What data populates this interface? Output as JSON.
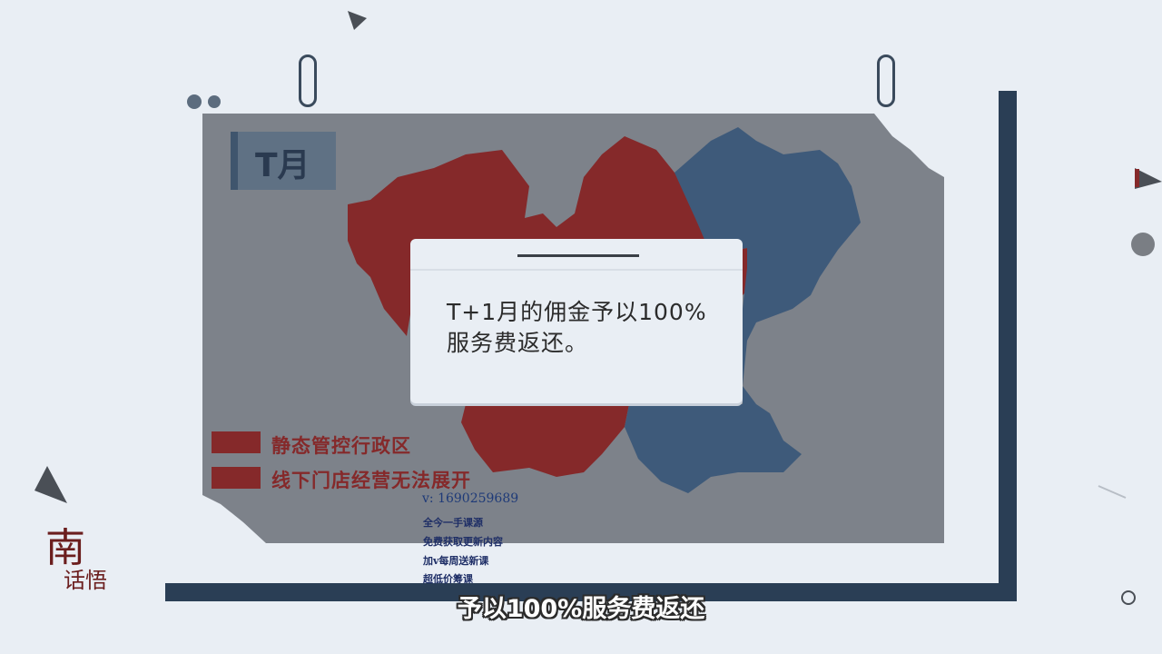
{
  "panel": {
    "month_badge": "T月",
    "legend": [
      {
        "label": "静态管控行政区",
        "color": "#85292a"
      },
      {
        "label": "线下门店经营无法展开",
        "color": "#85292a"
      }
    ],
    "map_colors": {
      "red_region": "#85292a",
      "blue_region": "#3e5a7a"
    }
  },
  "dialog": {
    "text": "T+1月的佣金予以100%服务费返还。"
  },
  "watermark": {
    "contact": "v: 1690259689",
    "lines": [
      "全今一手课源",
      "免费获取更新内容",
      "加v每周送新课",
      "超低价筹课"
    ]
  },
  "subtitle": "予以100%服务费返还",
  "logo": {
    "text_a": "南",
    "text_b": "话悟"
  },
  "colors": {
    "background": "#e9eef4",
    "frame": "#2a3e55",
    "panel": "#7d828a"
  }
}
